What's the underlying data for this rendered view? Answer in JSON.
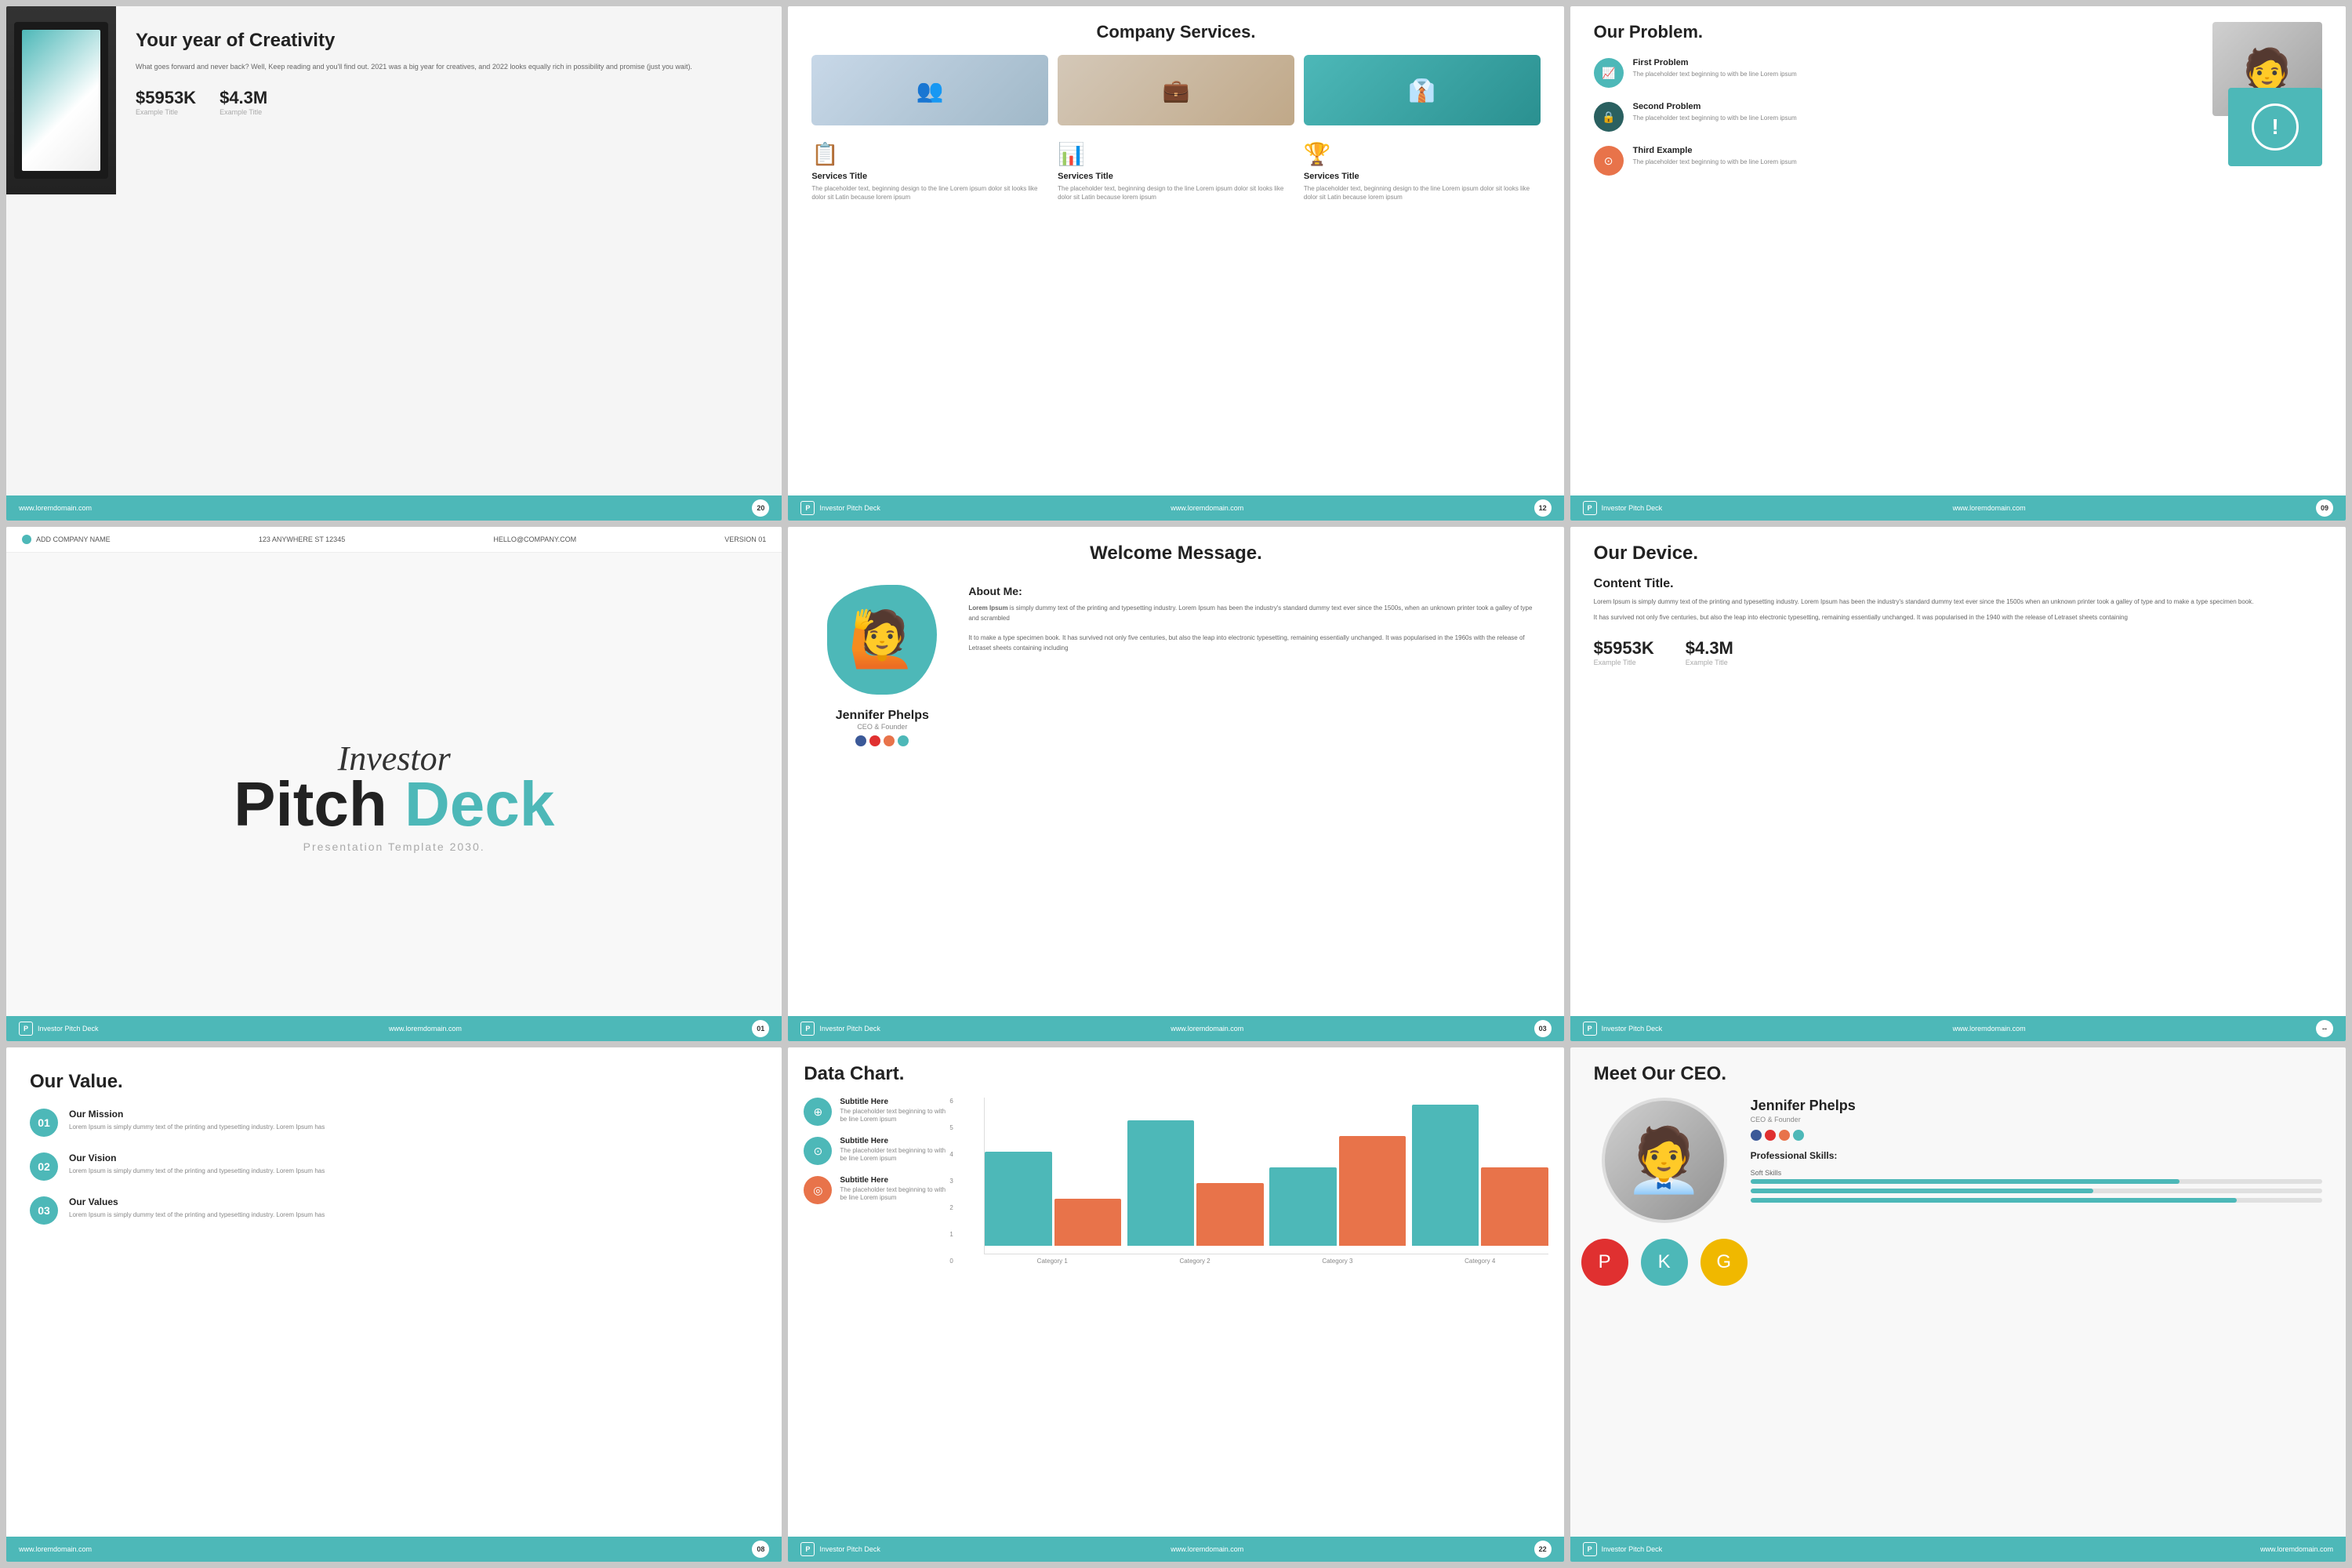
{
  "slides": {
    "slide1": {
      "title": "Your year of Creativity",
      "body": "What goes forward and never back? Well, Keep reading and you'll find out. 2021 was a big year for creatives, and 2022 looks equally rich in possibility and promise (just you wait).",
      "stat1_val": "$5953K",
      "stat1_label": "Example Title",
      "stat2_val": "$4.3M",
      "stat2_label": "Example Title",
      "page_num": "20",
      "footer_url": "www.loremdomain.com"
    },
    "slide2": {
      "title": "Company Services.",
      "service1_title": "Services Title",
      "service1_body": "The placeholder text, beginning design to the line Lorem ipsum dolor sit looks like dolor sit Latin because lorem ipsum",
      "service2_title": "Services Title",
      "service2_body": "The placeholder text, beginning design to the line Lorem ipsum dolor sit looks like dolor sit Latin because lorem ipsum",
      "service3_title": "Services Title",
      "service3_body": "The placeholder text, beginning design to the line Lorem ipsum dolor sit looks like dolor sit Latin because lorem ipsum",
      "page_num": "12",
      "deck_name": "Investor Pitch Deck",
      "footer_url": "www.loremdomain.com"
    },
    "slide3": {
      "title": "Our Problem.",
      "p1_title": "First Problem",
      "p1_body": "The placeholder text beginning to with be line Lorem ipsum",
      "p2_title": "Second Problem",
      "p2_body": "The placeholder text beginning to with be line Lorem ipsum",
      "p3_title": "Third Example",
      "p3_body": "The placeholder text beginning to with be line Lorem ipsum",
      "page_num": "09",
      "deck_name": "Investor Pitch Deck",
      "footer_url": "www.loremdomain.com"
    },
    "slide4": {
      "header_company": "ADD COMPANY NAME",
      "header_address": "123 ANYWHERE ST 12345",
      "header_email": "HELLO@COMPANY.COM",
      "header_version": "VERSION 01",
      "script_text": "Investor",
      "title_line1": "Pitch",
      "title_line2": "Deck",
      "subtitle": "Presentation Template 2030.",
      "page_num": "01",
      "deck_name": "Investor Pitch Deck",
      "footer_url": "www.loremdomain.com"
    },
    "slide5": {
      "title": "Welcome Message.",
      "name": "Jennifer Phelps",
      "person_title": "CEO & Founder",
      "about_heading": "About Me:",
      "about_text": "Lorem Ipsum is simply dummy text of the printing and typesetting industry. Lorem Ipsum has been the industry's standard dummy text ever since the 1500s, when an unknown printer took a galley of type and scrambled\n\nIt to make a type specimen book. It has survived not only five centuries, but also the leap into electronic typesetting, remaining essentially unchanged. It was popularised in the 1960s with the release of Letraset sheets containing  including",
      "page_num": "03",
      "deck_name": "Investor Pitch Deck",
      "footer_url": "www.loremdomain.com"
    },
    "slide6": {
      "title": "Our Device.",
      "content_title": "Content Title.",
      "body1": "Lorem Ipsum is simply dummy text of the printing and typesetting industry. Lorem Ipsum has been the industry's standard dummy text ever since the 1500s when an unknown printer took a galley of type and to make a type specimen book.",
      "body2": "It has survived not only five centuries, but also the leap into electronic typesetting, remaining essentially unchanged. It was popularised in the 1940 with the release of Letraset sheets containing",
      "stat1_val": "$5953K",
      "stat1_label": "Example Title",
      "stat2_val": "$4.3M",
      "stat2_label": "Example Title",
      "deck_name": "Investor Pitch Deck",
      "footer_url": "www.loremdomain.com"
    },
    "slide7": {
      "title": "Our Value.",
      "item1_num": "01",
      "item1_title": "Our Mission",
      "item1_body": "Lorem Ipsum is simply dummy text of the printing and typesetting industry. Lorem Ipsum has",
      "item2_num": "02",
      "item2_title": "Our Vision",
      "item2_body": "Lorem Ipsum is simply dummy text of the printing and typesetting industry. Lorem Ipsum has",
      "item3_num": "03",
      "item3_title": "Our Values",
      "item3_body": "Lorem Ipsum is simply dummy text of the printing and typesetting industry. Lorem Ipsum has",
      "page_num": "08",
      "footer_url": "www.loremdomain.com"
    },
    "slide8": {
      "title": "Data Chart.",
      "legend1_title": "Subtitle Here",
      "legend1_body": "The placeholder text beginning to with be line Lorem ipsum",
      "legend2_title": "Subtitle Here",
      "legend2_body": "The placeholder text beginning to with be line Lorem ipsum",
      "legend3_title": "Subtitle Here",
      "legend3_body": "The placeholder text beginning to with be line Lorem ipsum",
      "cat1": "Category 1",
      "cat2": "Category 2",
      "cat3": "Category 3",
      "cat4": "Category 4",
      "y_max": "6",
      "y5": "5",
      "y4": "4",
      "y3": "3",
      "y2": "2",
      "y1": "1",
      "y0": "0",
      "page_num": "22",
      "deck_name": "Investor Pitch Deck",
      "footer_url": "www.loremdomain.com"
    },
    "slide9": {
      "title": "Meet Our CEO.",
      "ceo_name": "Jennifer Phelps",
      "ceo_title": "CEO & Founder",
      "skills_title": "Professional Skills:",
      "skill1_name": "Soft Skills",
      "skill1_pct": 75,
      "skill2_name": "",
      "skill2_pct": 60,
      "skill3_name": "",
      "skill3_pct": 85,
      "deck_name": "Investor Pitch Deck",
      "footer_url": "www.loremdomain.com"
    }
  }
}
